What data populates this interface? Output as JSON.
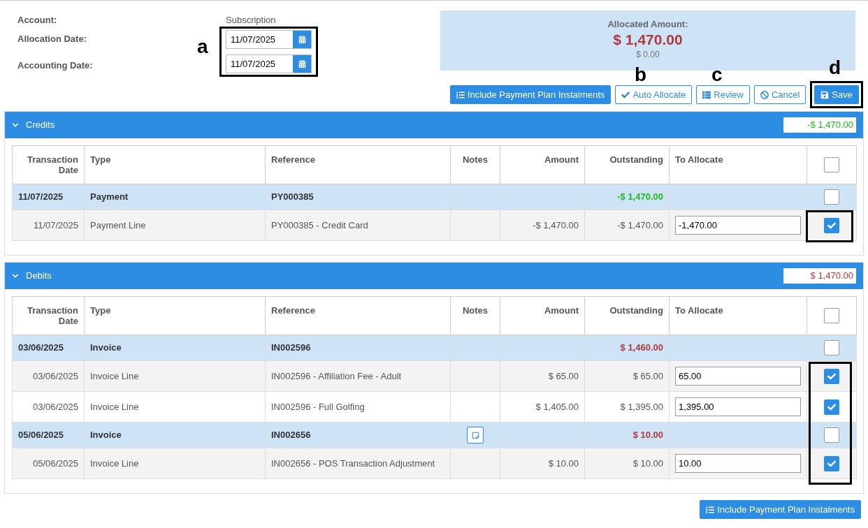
{
  "header": {
    "fields": [
      {
        "label": "Account:",
        "kind": "text",
        "value": "Subscription"
      },
      {
        "label": "Allocation Date:",
        "kind": "date",
        "value": "11/07/2025"
      },
      {
        "label": "Accounting Date:",
        "kind": "date",
        "value": "11/07/2025"
      }
    ]
  },
  "summary": {
    "label": "Allocated Amount:",
    "amount": "$ 1,470.00",
    "remaining": "$ 0.00"
  },
  "toolbar": [
    {
      "label": "Include Payment Plan Instalments",
      "kind": "instalments"
    },
    {
      "label": "Auto Allocate",
      "kind": "auto"
    },
    {
      "label": "Review",
      "kind": "review"
    },
    {
      "label": "Cancel",
      "kind": "cancel"
    },
    {
      "label": "Save",
      "kind": "save"
    }
  ],
  "callouts": [
    {
      "label": "a"
    },
    {
      "label": "b"
    },
    {
      "label": "c"
    },
    {
      "label": "d"
    }
  ],
  "panels": [
    {
      "title": "Credits",
      "expanded": true,
      "total": "-$ 1,470.00",
      "kind": "credit",
      "columns": [
        "Transaction Date",
        "Type",
        "Reference",
        "Notes",
        "Amount",
        "Outstanding",
        "To Allocate"
      ],
      "header_checked": false,
      "rows": [
        {
          "kind": "group",
          "date": "11/07/2025",
          "type": "Payment",
          "reference": "PY000385",
          "has_note": false,
          "outstanding": "-$ 1,470.00",
          "checked": false
        },
        {
          "kind": "line",
          "date": "11/07/2025",
          "type": "Payment Line",
          "reference": "PY000385 - Credit Card",
          "amount": "-$ 1,470.00",
          "outstanding": "-$ 1,470.00",
          "allocate": "-1,470.00",
          "checked": true
        }
      ]
    },
    {
      "title": "Debits",
      "expanded": true,
      "total": "$ 1,470.00",
      "kind": "debit",
      "columns": [
        "Transaction Date",
        "Type",
        "Reference",
        "Notes",
        "Amount",
        "Outstanding",
        "To Allocate"
      ],
      "header_checked": false,
      "rows": [
        {
          "kind": "group",
          "date": "03/06/2025",
          "type": "Invoice",
          "reference": "IN002596",
          "has_note": false,
          "outstanding": "$ 1,460.00",
          "checked": false
        },
        {
          "kind": "line",
          "date": "03/06/2025",
          "type": "Invoice Line",
          "reference": "IN002596 - Affiliation Fee - Adult",
          "amount": "$ 65.00",
          "outstanding": "$ 65.00",
          "allocate": "65.00",
          "checked": true
        },
        {
          "kind": "line",
          "date": "03/06/2025",
          "type": "Invoice Line",
          "reference": "IN002596 - Full Golfing",
          "amount": "$ 1,405.00",
          "outstanding": "$ 1,395.00",
          "allocate": "1,395.00",
          "checked": true
        },
        {
          "kind": "group",
          "date": "05/06/2025",
          "type": "Invoice",
          "reference": "IN002656",
          "has_note": true,
          "outstanding": "$ 10.00",
          "checked": false
        },
        {
          "kind": "line",
          "date": "05/06/2025",
          "type": "Invoice Line",
          "reference": "IN002656 - POS Transaction Adjustment",
          "amount": "$ 10.00",
          "outstanding": "$ 10.00",
          "allocate": "10.00",
          "checked": true
        }
      ]
    }
  ],
  "footer_button": {
    "label": "Include Payment Plan Instalments",
    "kind": "instalments"
  }
}
